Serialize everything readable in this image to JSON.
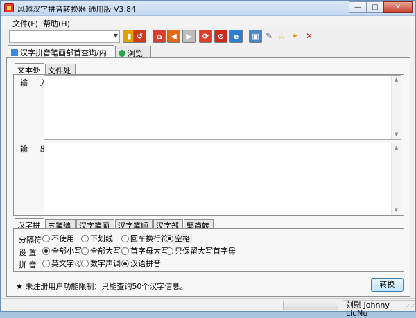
{
  "window": {
    "title": "风越汉字拼音转换器 通用版 V3.84",
    "buttons": {
      "minimize": "—",
      "maximize": "□",
      "close": "✕"
    }
  },
  "menu": {
    "items": [
      "文件(F)",
      "帮助(H)"
    ]
  },
  "toolbar": {
    "combo_value": "",
    "buttons": [
      {
        "name": "lock-icon",
        "glyph": "▮",
        "color": "#e0a000"
      },
      {
        "name": "refresh-icon",
        "glyph": "↺",
        "color": "#d23a1e"
      },
      {
        "name": "home-icon",
        "glyph": "⌂",
        "color": "#d8402a"
      },
      {
        "name": "back-icon",
        "glyph": "◀",
        "color": "#e06a1a"
      },
      {
        "name": "forward-icon",
        "glyph": "▶",
        "color": "#bdbdbd"
      },
      {
        "name": "reload-icon",
        "glyph": "⟳",
        "color": "#d8402a"
      },
      {
        "name": "stop-icon",
        "glyph": "⊘",
        "color": "#cc2a1c"
      },
      {
        "name": "ie-icon",
        "glyph": "e",
        "color": "#2f7fd0"
      },
      {
        "name": "window-icon",
        "glyph": "▣",
        "color": "#4a86c6"
      },
      {
        "name": "tools-icon",
        "glyph": "✎",
        "color": "#6c6c6c"
      },
      {
        "name": "star-icon",
        "glyph": "☆",
        "color": "#e0b000"
      },
      {
        "name": "key-icon",
        "glyph": "✦",
        "color": "#d0a000"
      },
      {
        "name": "exit-icon",
        "glyph": "✕",
        "color": "#d02020"
      }
    ]
  },
  "top_tabs": [
    {
      "label": "汉字拼音笔画部首查询/内码转换",
      "active": true
    },
    {
      "label": "浏览器",
      "active": false
    }
  ],
  "inner_tabs": [
    {
      "label": "文本处理",
      "active": true
    },
    {
      "label": "文件处理",
      "active": false
    }
  ],
  "io": {
    "input_label": "输 入",
    "output_label": "输 出",
    "input_value": "",
    "output_value": ""
  },
  "option_tabs": [
    {
      "label": "汉字拼音",
      "active": true
    },
    {
      "label": "五笔编码",
      "active": false
    },
    {
      "label": "汉字笔画数",
      "active": false
    },
    {
      "label": "汉字笔顺名",
      "active": false
    },
    {
      "label": "汉字部首",
      "active": false
    },
    {
      "label": "繁简转换",
      "active": false
    }
  ],
  "options": {
    "separator": {
      "label": "分隔符",
      "choices": [
        "不使用",
        "下划线",
        "回车换行符",
        "空格"
      ],
      "selected": "空格"
    },
    "setting": {
      "label": "设 置",
      "choices": [
        "全部小写",
        "全部大写",
        "首字母大写",
        "只保留大写首字母"
      ],
      "selected": "全部小写"
    },
    "pinyin": {
      "label": "拼 音",
      "choices": [
        "英文字母",
        "数字声调",
        "汉语拼音"
      ],
      "selected": "汉语拼音"
    }
  },
  "notice": "★ 未注册用户功能限制：只能查询50个汉字信息。",
  "convert_button": "转换",
  "status": {
    "author": "刘慰 Johnny LiuNu"
  }
}
